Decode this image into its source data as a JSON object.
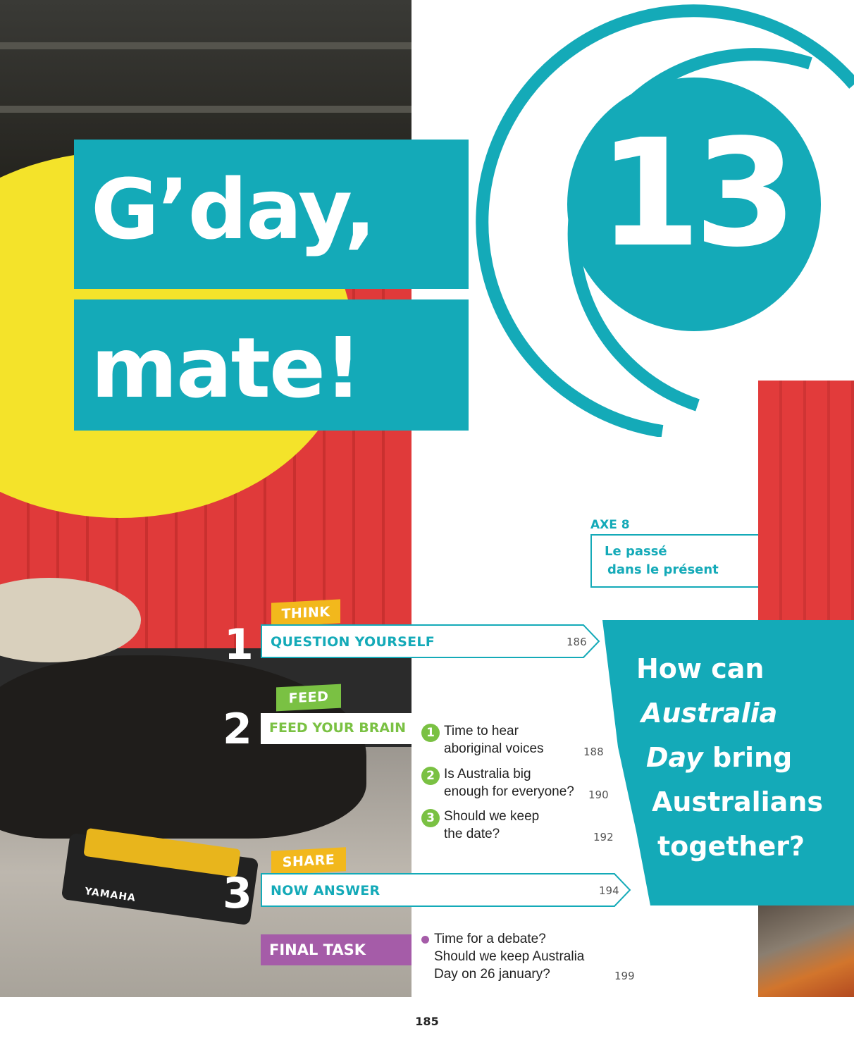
{
  "chapter": {
    "number": "13",
    "title_line_1": "G’day,",
    "title_line_2": "mate!",
    "accent_color": "#14aab8"
  },
  "axe": {
    "label": "AXE 8",
    "line_1": "Le passé",
    "line_2": "dans le présent"
  },
  "question": {
    "line_1": "How can",
    "line_2": "Australia",
    "line_3_italic": "Day",
    "line_3_rest": " bring",
    "line_4": "Australians",
    "line_5": "together?"
  },
  "steps": {
    "think": {
      "tag": "THINK",
      "number": "1",
      "title": "QUESTION YOURSELF",
      "page": "186",
      "color": "#f2b81c"
    },
    "feed": {
      "tag": "FEED",
      "number": "2",
      "title": "FEED YOUR BRAIN",
      "color": "#7ac143"
    },
    "share": {
      "tag": "SHARE",
      "number": "3",
      "title": "NOW ANSWER",
      "page": "194",
      "color": "#f2b81c"
    }
  },
  "feed_items": [
    {
      "num": "1",
      "line_1": "Time to hear",
      "line_2": "aboriginal voices",
      "page": "188"
    },
    {
      "num": "2",
      "line_1": "Is Australia big",
      "line_2": "enough for everyone?",
      "page": "190"
    },
    {
      "num": "3",
      "line_1": "Should we keep",
      "line_2": "the date?",
      "page": "192"
    }
  ],
  "final_task": {
    "label": "FINAL TASK",
    "line_1": "Time for a debate?",
    "line_2": "Should we keep Australia",
    "line_3": "Day on 26 january?",
    "page": "199",
    "color": "#a55ca8"
  },
  "photo": {
    "brand_text": "YAMAHA"
  },
  "footer": {
    "page_number": "185"
  }
}
